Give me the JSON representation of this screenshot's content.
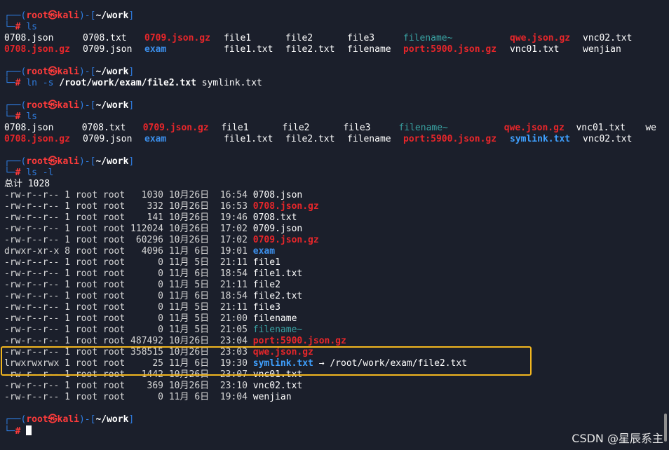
{
  "prompt": {
    "user": "root",
    "at": "㉿",
    "host": "kali",
    "path": "~/work",
    "hash": "#"
  },
  "commands": {
    "ls1": "ls",
    "ln": "ln -s ",
    "ln_target": "/root/work/exam/file2.txt",
    "ln_name": " symlink.txt",
    "ls2": "ls",
    "lsl": "ls -l"
  },
  "ls1": {
    "row1": [
      "0708.json",
      "0708.txt",
      "0709.json.gz",
      "file1",
      "file2",
      "file3",
      "filename~",
      "qwe.json.gz",
      "vnc02.txt"
    ],
    "row2": [
      "0708.json.gz",
      "0709.json",
      "exam",
      "file1.txt",
      "file2.txt",
      "filename",
      "port:5900.json.gz",
      "vnc01.txt",
      "wenjian"
    ]
  },
  "ls2": {
    "row1": [
      "0708.json",
      "0708.txt",
      "0709.json.gz",
      "file1",
      "file2",
      "file3",
      "filename~",
      "qwe.json.gz",
      "vnc01.txt",
      "we"
    ],
    "row2": [
      "0708.json.gz",
      "0709.json",
      "exam",
      "file1.txt",
      "file2.txt",
      "filename",
      "port:5900.json.gz",
      "symlink.txt",
      "vnc02.txt"
    ]
  },
  "total": "总计 1028",
  "listing": [
    {
      "perm": "-rw-r--r--",
      "links": "1",
      "owner": "root",
      "group": "root",
      "size": "1030",
      "month": "10月",
      "day": "26日",
      "time": "16:54",
      "name": "0708.json",
      "kind": "file"
    },
    {
      "perm": "-rw-r--r--",
      "links": "1",
      "owner": "root",
      "group": "root",
      "size": "332",
      "month": "10月",
      "day": "26日",
      "time": "16:53",
      "name": "0708.json.gz",
      "kind": "gz"
    },
    {
      "perm": "-rw-r--r--",
      "links": "1",
      "owner": "root",
      "group": "root",
      "size": "141",
      "month": "10月",
      "day": "26日",
      "time": "19:46",
      "name": "0708.txt",
      "kind": "file"
    },
    {
      "perm": "-rw-r--r--",
      "links": "1",
      "owner": "root",
      "group": "root",
      "size": "112024",
      "month": "10月",
      "day": "26日",
      "time": "17:02",
      "name": "0709.json",
      "kind": "file"
    },
    {
      "perm": "-rw-r--r--",
      "links": "1",
      "owner": "root",
      "group": "root",
      "size": "60296",
      "month": "10月",
      "day": "26日",
      "time": "17:02",
      "name": "0709.json.gz",
      "kind": "gz"
    },
    {
      "perm": "drwxr-xr-x",
      "links": "8",
      "owner": "root",
      "group": "root",
      "size": "4096",
      "month": "11月",
      "day": "6日",
      "time": "19:01",
      "name": "exam",
      "kind": "dir"
    },
    {
      "perm": "-rw-r--r--",
      "links": "1",
      "owner": "root",
      "group": "root",
      "size": "0",
      "month": "11月",
      "day": "5日",
      "time": "21:11",
      "name": "file1",
      "kind": "file"
    },
    {
      "perm": "-rw-r--r--",
      "links": "1",
      "owner": "root",
      "group": "root",
      "size": "0",
      "month": "11月",
      "day": "6日",
      "time": "18:54",
      "name": "file1.txt",
      "kind": "file"
    },
    {
      "perm": "-rw-r--r--",
      "links": "1",
      "owner": "root",
      "group": "root",
      "size": "0",
      "month": "11月",
      "day": "5日",
      "time": "21:11",
      "name": "file2",
      "kind": "file"
    },
    {
      "perm": "-rw-r--r--",
      "links": "1",
      "owner": "root",
      "group": "root",
      "size": "0",
      "month": "11月",
      "day": "6日",
      "time": "18:54",
      "name": "file2.txt",
      "kind": "file"
    },
    {
      "perm": "-rw-r--r--",
      "links": "1",
      "owner": "root",
      "group": "root",
      "size": "0",
      "month": "11月",
      "day": "5日",
      "time": "21:11",
      "name": "file3",
      "kind": "file"
    },
    {
      "perm": "-rw-r--r--",
      "links": "1",
      "owner": "root",
      "group": "root",
      "size": "0",
      "month": "11月",
      "day": "5日",
      "time": "21:00",
      "name": "filename",
      "kind": "file"
    },
    {
      "perm": "-rw-r--r--",
      "links": "1",
      "owner": "root",
      "group": "root",
      "size": "0",
      "month": "11月",
      "day": "5日",
      "time": "21:05",
      "name": "filename~",
      "kind": "tilde"
    },
    {
      "perm": "-rw-r--r--",
      "links": "1",
      "owner": "root",
      "group": "root",
      "size": "487492",
      "month": "10月",
      "day": "26日",
      "time": "23:04",
      "name": "port:5900.json.gz",
      "kind": "gz"
    },
    {
      "perm": "-rw-r--r--",
      "links": "1",
      "owner": "root",
      "group": "root",
      "size": "358515",
      "month": "10月",
      "day": "26日",
      "time": "23:03",
      "name": "qwe.json.gz",
      "kind": "gz"
    },
    {
      "perm": "lrwxrwxrwx",
      "links": "1",
      "owner": "root",
      "group": "root",
      "size": "25",
      "month": "11月",
      "day": "6日",
      "time": "19:30",
      "name": "symlink.txt",
      "kind": "link",
      "arrow": " → ",
      "target": "/root/work/exam/file2.txt"
    },
    {
      "perm": "-rw-r--r--",
      "links": "1",
      "owner": "root",
      "group": "root",
      "size": "1442",
      "month": "10月",
      "day": "26日",
      "time": "23:07",
      "name": "vnc01.txt",
      "kind": "file"
    },
    {
      "perm": "-rw-r--r--",
      "links": "1",
      "owner": "root",
      "group": "root",
      "size": "369",
      "month": "10月",
      "day": "26日",
      "time": "23:10",
      "name": "vnc02.txt",
      "kind": "file"
    },
    {
      "perm": "-rw-r--r--",
      "links": "1",
      "owner": "root",
      "group": "root",
      "size": "0",
      "month": "11月",
      "day": "6日",
      "time": "19:04",
      "name": "wenjian",
      "kind": "file"
    }
  ],
  "watermark": "CSDN @星辰系主",
  "colors": {
    "background": "#1b1f2b",
    "prompt_frame": "#2f7de1",
    "prompt_user": "#ff3b3b",
    "gz": "#e8262a",
    "dir": "#3b8eea",
    "highlight": "#f2b61f"
  }
}
